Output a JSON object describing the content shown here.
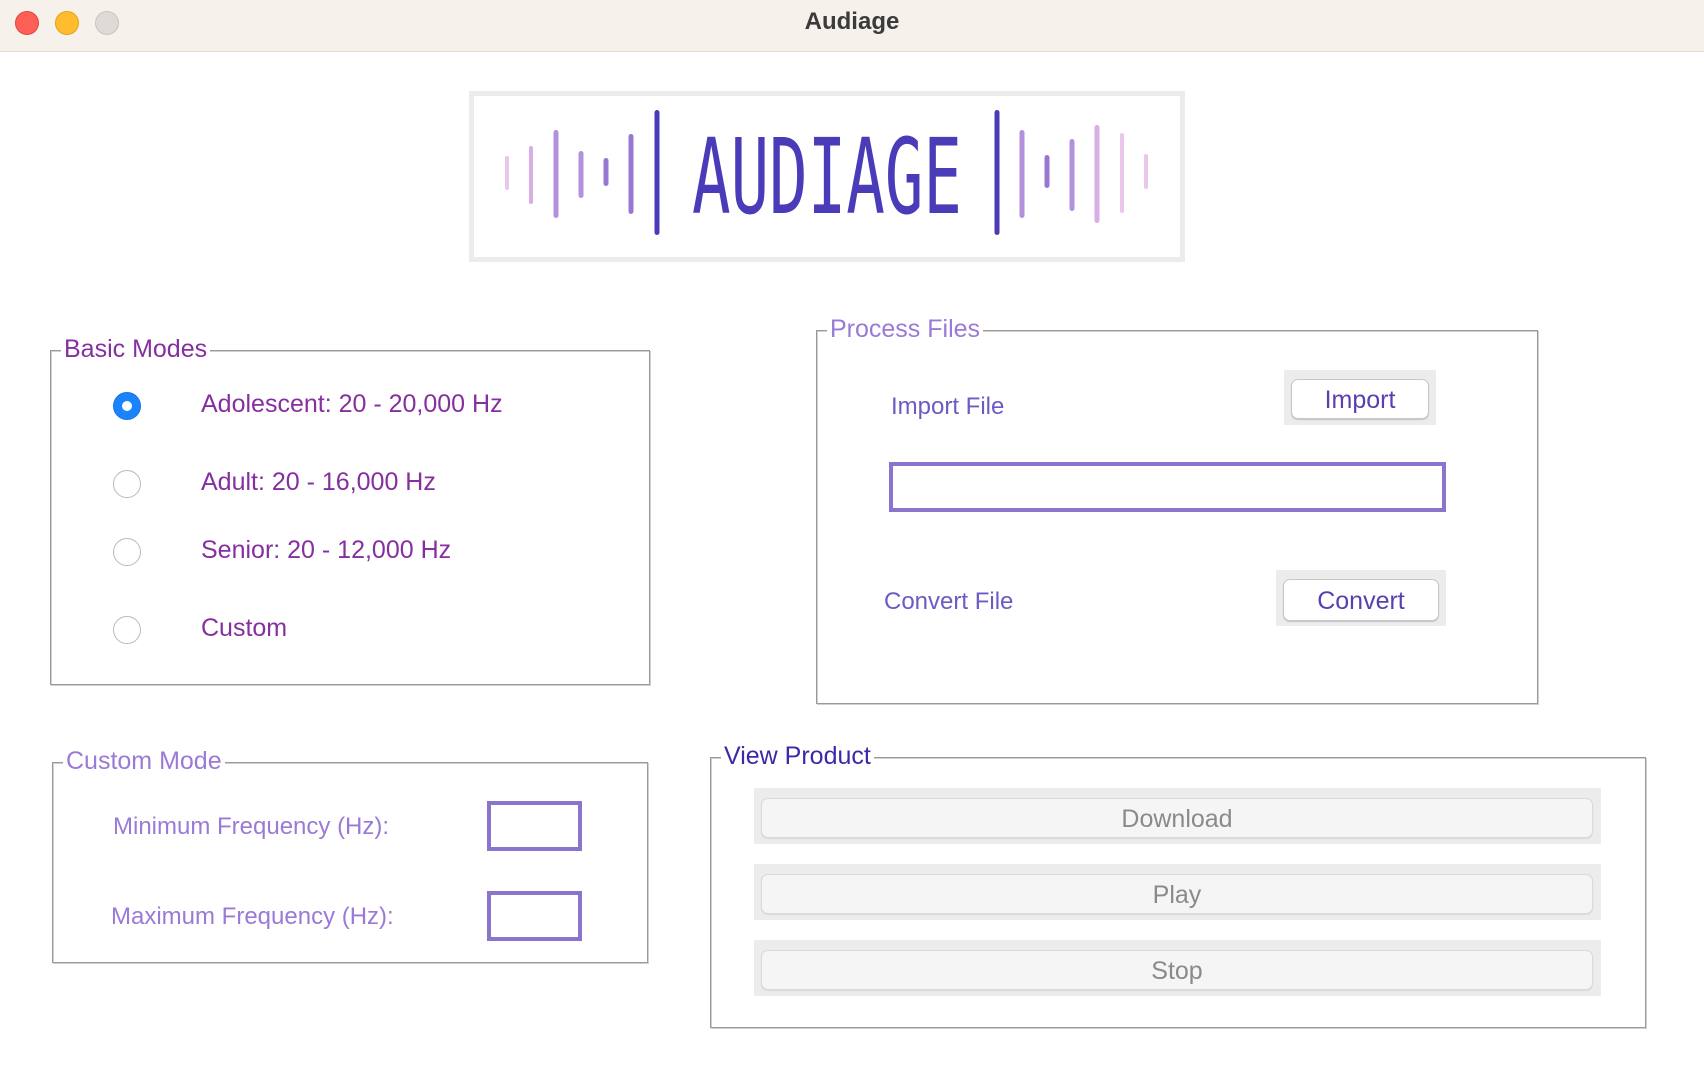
{
  "window": {
    "title": "Audiage"
  },
  "logo": {
    "text": "AUDIAGE",
    "bar_colors": [
      "#e9c6ea",
      "#d7aee6",
      "#b391dd",
      "#9777d1",
      "#4a3bb8"
    ]
  },
  "basic_modes": {
    "legend": "Basic Modes",
    "options": [
      {
        "label": "Adolescent: 20 - 20,000 Hz",
        "selected": true
      },
      {
        "label": "Adult: 20 - 16,000 Hz",
        "selected": false
      },
      {
        "label": "Senior: 20 - 12,000 Hz",
        "selected": false
      },
      {
        "label": "Custom",
        "selected": false
      }
    ]
  },
  "custom_mode": {
    "legend": "Custom Mode",
    "min_label": "Minimum Frequency (Hz):",
    "min_value": "",
    "max_label": "Maximum Frequency (Hz):",
    "max_value": ""
  },
  "process_files": {
    "legend": "Process Files",
    "import_label": "Import File",
    "import_button": "Import",
    "file_path_value": "",
    "convert_label": "Convert File",
    "convert_button": "Convert"
  },
  "view_product": {
    "legend": "View Product",
    "download_button": "Download",
    "play_button": "Play",
    "stop_button": "Stop"
  },
  "colors": {
    "purple_dark": "#862fa0",
    "purple_mid": "#6a5cc4",
    "purple_light": "#9a7ad6",
    "navy": "#3a2aa8",
    "radio_selected": "#1a84ff"
  }
}
